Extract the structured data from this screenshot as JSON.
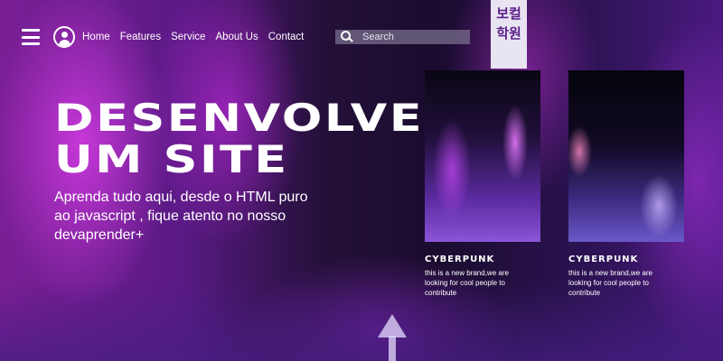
{
  "nav": {
    "links": [
      {
        "label": "Home"
      },
      {
        "label": "Features"
      },
      {
        "label": "Service"
      },
      {
        "label": "About Us"
      },
      {
        "label": "Contact"
      }
    ]
  },
  "search": {
    "placeholder": "Search",
    "icon": "search-icon"
  },
  "hero": {
    "title_line1": "DESENVOLVER",
    "title_line2": "UM SITE",
    "subtitle": "Aprenda tudo aqui, desde o HTML puro ao javascript , fique atento no nosso devaprender+"
  },
  "cards": [
    {
      "title": "CYBERPUNK",
      "text": "this is a new brand,we are looking for cool people to contribute"
    },
    {
      "title": "CYBERPUNK",
      "text": "this is a new brand,we are looking for cool people to contribute"
    }
  ],
  "background_sign": {
    "line1": "보컬",
    "line2": "학원"
  },
  "colors": {
    "text": "#ffffff",
    "accent_purple": "#7a1f95",
    "search_bg": "#786e8c"
  }
}
